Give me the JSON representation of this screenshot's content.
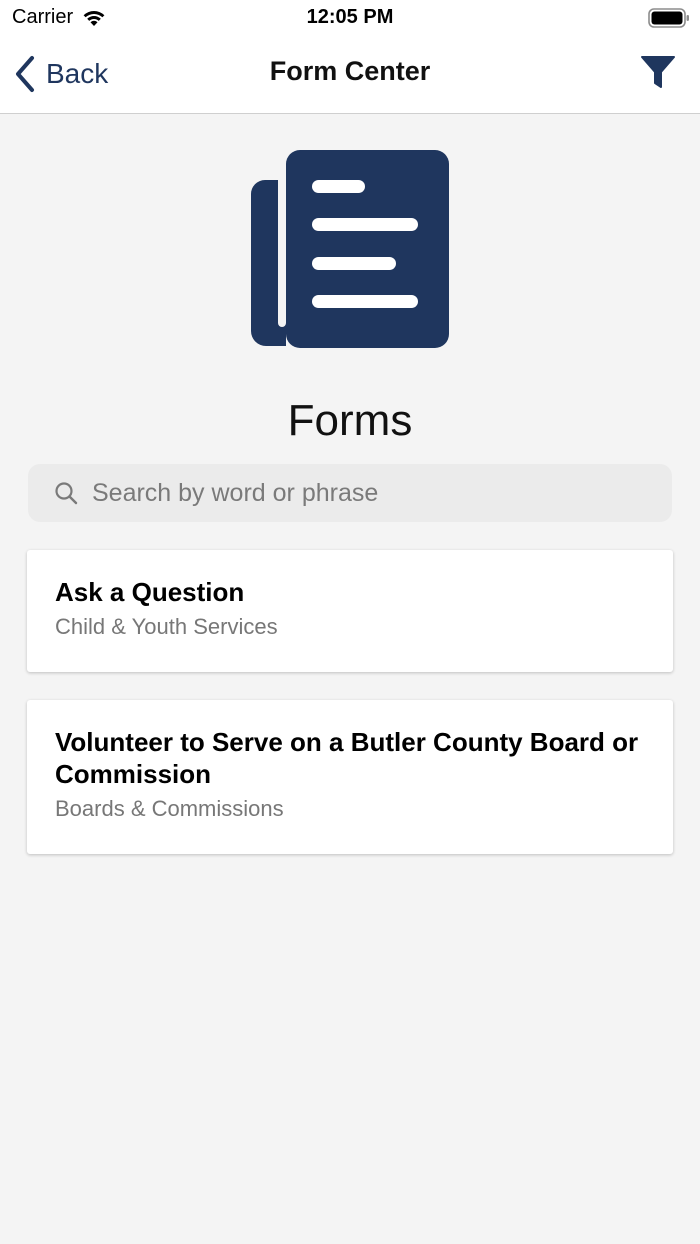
{
  "status_bar": {
    "carrier": "Carrier",
    "time": "12:05 PM",
    "wifi_icon": "wifi-icon",
    "battery_icon": "battery-icon"
  },
  "nav": {
    "back_label": "Back",
    "title": "Form Center",
    "back_icon": "chevron-left-icon",
    "filter_icon": "filter-icon"
  },
  "hero": {
    "icon": "forms-document-icon",
    "heading": "Forms"
  },
  "search": {
    "placeholder": "Search by word or phrase",
    "value": "",
    "icon": "search-icon"
  },
  "forms": [
    {
      "title": "Ask a Question",
      "category": "Child & Youth Services"
    },
    {
      "title": "Volunteer to Serve on a Butler County Board or Commission",
      "category": "Boards & Commissions"
    }
  ],
  "colors": {
    "brand": "#1f365e",
    "background": "#f4f4f4",
    "card": "#ffffff",
    "subtitle": "#777777"
  }
}
